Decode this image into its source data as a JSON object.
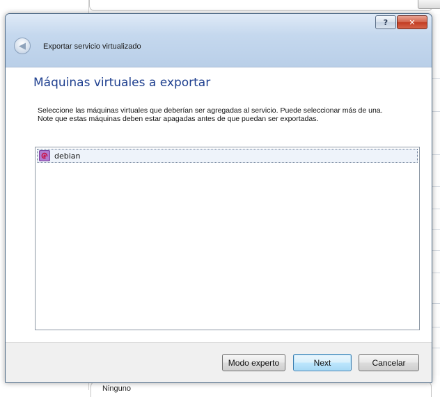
{
  "background": {
    "bottom_field_text": "Ninguno"
  },
  "window": {
    "help_label": "?",
    "close_label": "✕",
    "back_icon": "back-arrow-icon",
    "wizard_title": "Exportar servicio virtualizado"
  },
  "page": {
    "heading": "Máquinas virtuales a exportar",
    "description": "Seleccione las máquinas virtuales que deberían ser agregadas al servicio. Puede seleccionar más de una. Note que estas máquinas deben estar apagadas antes de que puedan ser exportadas."
  },
  "vm_list": {
    "items": [
      {
        "name": "debian",
        "icon": "debian-swirl-icon",
        "selected": true
      }
    ]
  },
  "buttons": {
    "expert": "Modo experto",
    "next": "Next",
    "cancel": "Cancelar"
  },
  "colors": {
    "heading": "#1e3f8f",
    "close_button": "#c23c22",
    "default_button_border": "#3c7fb1"
  }
}
